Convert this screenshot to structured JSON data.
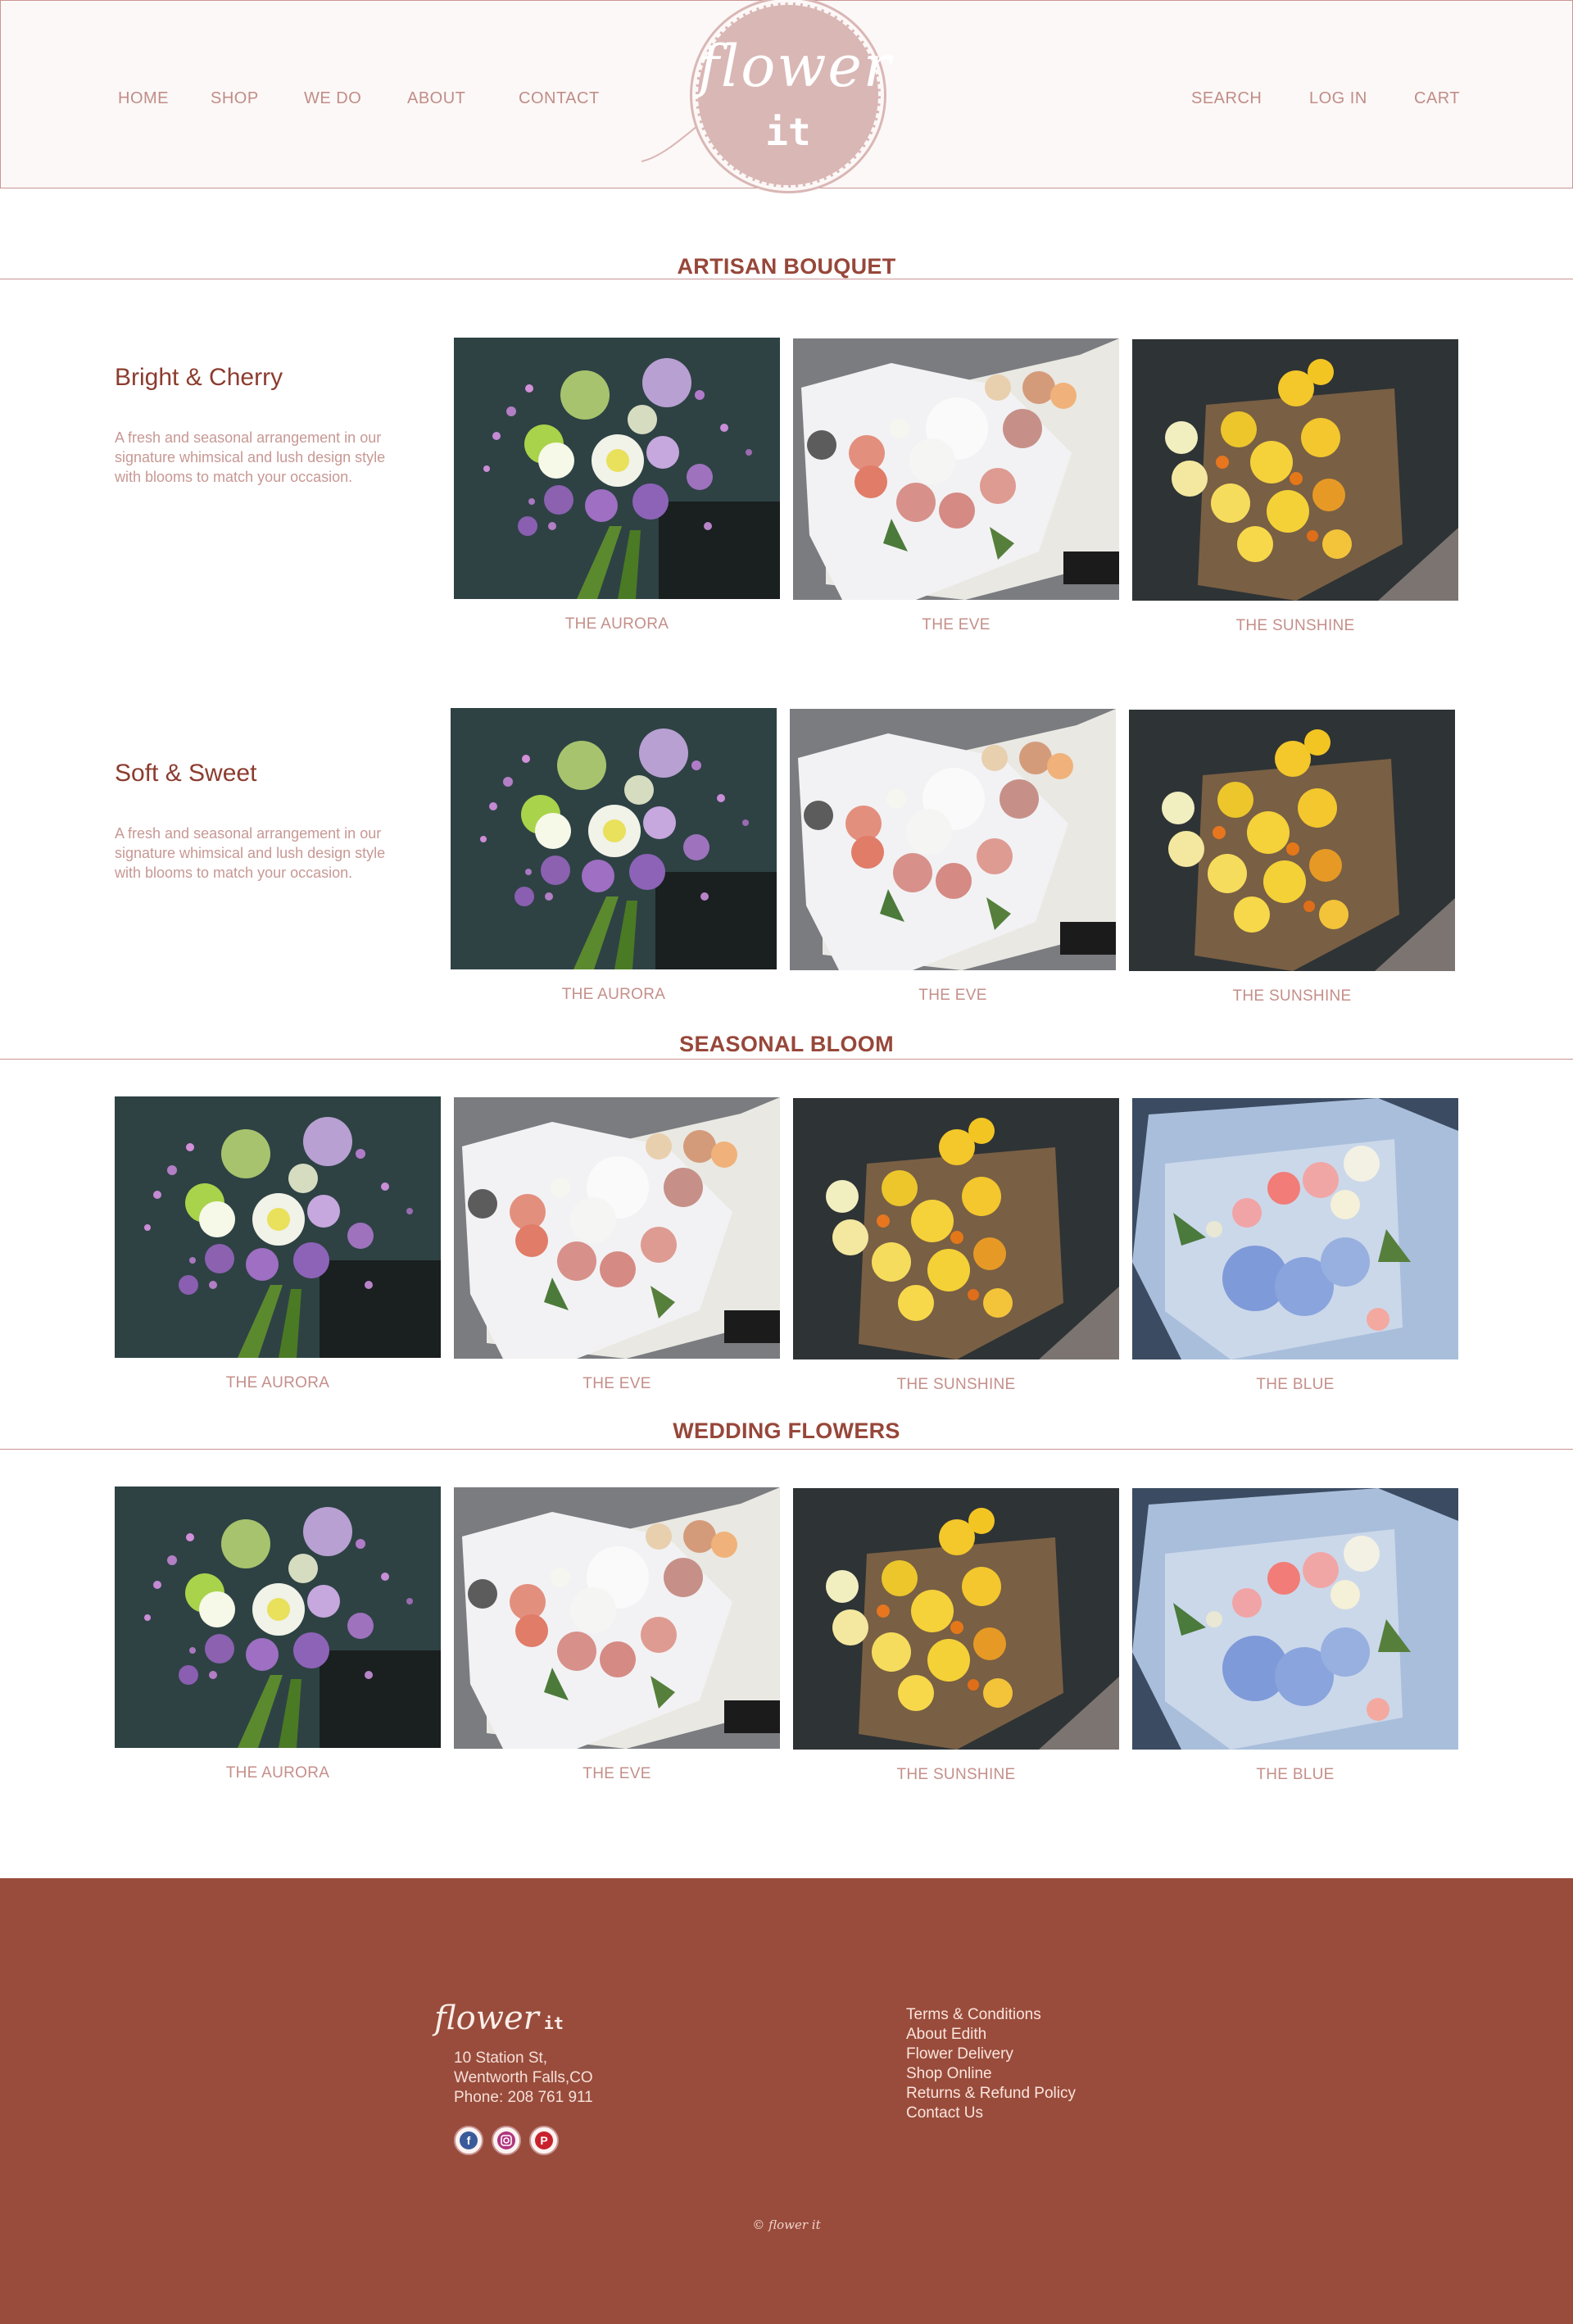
{
  "header": {
    "nav_left": [
      "HOME",
      "SHOP",
      "WE DO",
      "ABOUT",
      "CONTACT"
    ],
    "nav_right": [
      "SEARCH",
      "LOG IN",
      "CART"
    ],
    "logo": {
      "script": "flower",
      "suffix": "it"
    }
  },
  "artisan": {
    "title": "ARTISAN BOUQUET",
    "rows": [
      {
        "title": "Bright & Cherry",
        "description": "A fresh and seasonal arrangement in our signature whimsical and lush design style with blooms to match your occasion.",
        "items": [
          "THE AURORA",
          "THE EVE",
          "THE SUNSHINE"
        ]
      },
      {
        "title": "Soft & Sweet",
        "description": "A fresh and seasonal arrangement in our signature whimsical and lush design style with blooms to match your occasion.",
        "items": [
          "THE AURORA",
          "THE EVE",
          "THE SUNSHINE"
        ]
      }
    ]
  },
  "seasonal": {
    "title": "SEASONAL BLOOM",
    "items": [
      "THE AURORA",
      "THE EVE",
      "THE SUNSHINE",
      "THE BLUE"
    ]
  },
  "wedding": {
    "title": "WEDDING FLOWERS",
    "items": [
      "THE AURORA",
      "THE EVE",
      "THE SUNSHINE",
      "THE BLUE"
    ]
  },
  "footer": {
    "logo": {
      "script": "flower",
      "suffix": "it"
    },
    "address": [
      "10 Station St,",
      "Wentworth Falls,CO",
      "Phone: 208 761 911"
    ],
    "social": [
      "facebook-icon",
      "instagram-icon",
      "pinterest-icon"
    ],
    "links": [
      "Terms & Conditions",
      "About Edith",
      "Flower Delivery",
      "Shop Online",
      "Returns & Refund Policy",
      "Contact Us"
    ],
    "copyright": "© flower it"
  },
  "colors": {
    "accent": "#97473a",
    "footer_bg": "#994c3b",
    "header_bg": "#fcf8f7",
    "border": "#c99594"
  }
}
